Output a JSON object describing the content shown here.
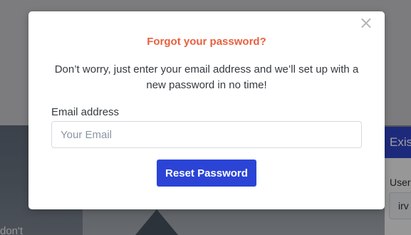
{
  "background": {
    "hero_text": "don't",
    "side_panel": {
      "header": "Existing",
      "label": "User",
      "input_value": "irv"
    }
  },
  "modal": {
    "close_symbol": "×",
    "close_icon": "close-icon",
    "title": "Forgot your password?",
    "description": "Don’t worry, just enter your email address and we’ll set up with a new password in no time!",
    "email_label": "Email address",
    "email_placeholder": "Your Email",
    "email_value": "",
    "submit_label": "Reset Password"
  },
  "colors": {
    "title": "#e8603f",
    "button": "#2b44d6",
    "side_header": "#2f45c9"
  }
}
